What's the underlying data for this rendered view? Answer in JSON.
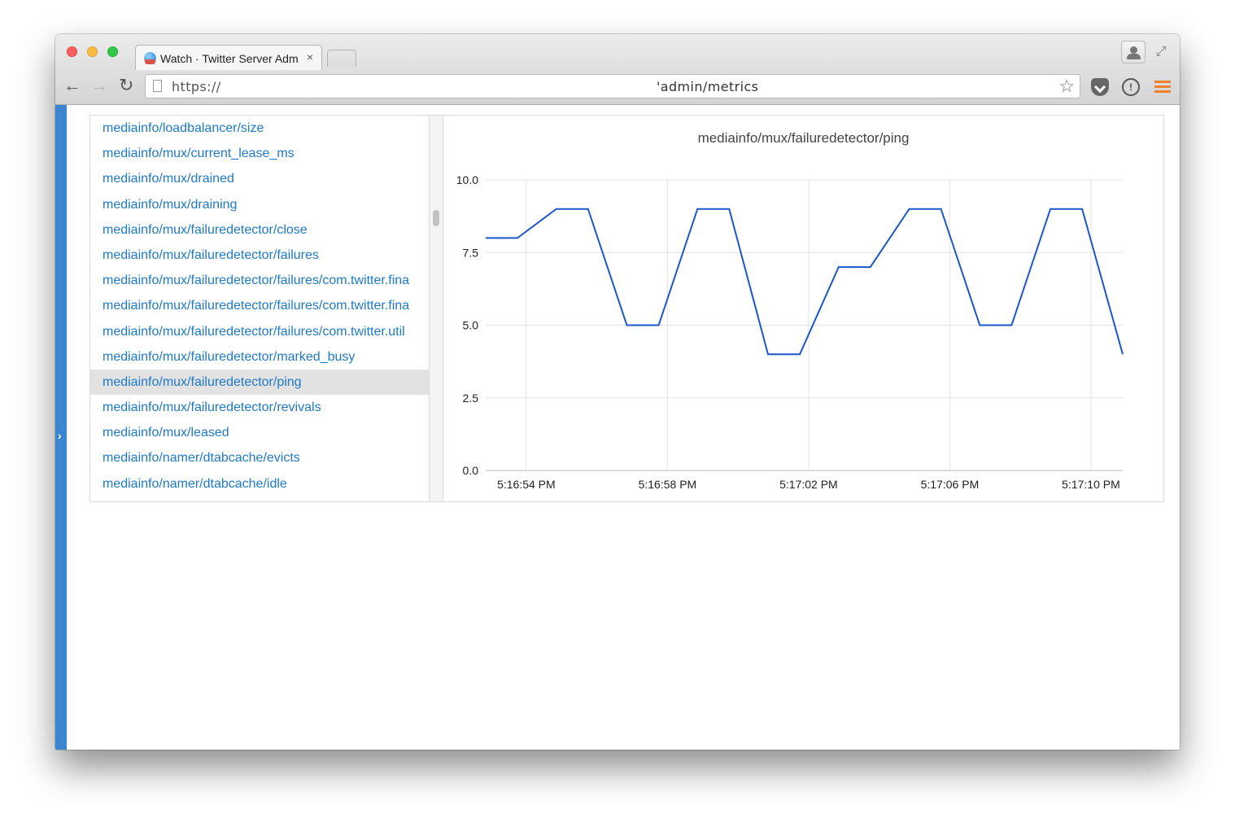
{
  "browser": {
    "tab_title": "Watch · Twitter Server Adm",
    "tab_close": "×",
    "url_scheme": "https://",
    "url_path": "'admin/metrics"
  },
  "metrics": {
    "items": [
      "mediainfo/loadbalancer/size",
      "mediainfo/mux/current_lease_ms",
      "mediainfo/mux/drained",
      "mediainfo/mux/draining",
      "mediainfo/mux/failuredetector/close",
      "mediainfo/mux/failuredetector/failures",
      "mediainfo/mux/failuredetector/failures/com.twitter.fina",
      "mediainfo/mux/failuredetector/failures/com.twitter.fina",
      "mediainfo/mux/failuredetector/failures/com.twitter.util",
      "mediainfo/mux/failuredetector/marked_busy",
      "mediainfo/mux/failuredetector/ping",
      "mediainfo/mux/failuredetector/revivals",
      "mediainfo/mux/leased",
      "mediainfo/namer/dtabcache/evicts",
      "mediainfo/namer/dtabcache/idle"
    ],
    "selected_index": 10
  },
  "chart_data": {
    "type": "line",
    "title": "mediainfo/mux/failuredetector/ping",
    "xlabel": "",
    "ylabel": "",
    "ylim": [
      0,
      10
    ],
    "yticks": [
      "0.0",
      "2.5",
      "5.0",
      "7.5",
      "10.0"
    ],
    "xticks": [
      "5:16:54 PM",
      "5:16:58 PM",
      "5:17:02 PM",
      "5:17:06 PM",
      "5:17:10 PM"
    ],
    "xlim_seconds": [
      -1.15,
      16.9
    ],
    "grid": true,
    "color": "#1a56cc",
    "series": [
      {
        "x": [
          -1.15,
          -0.25,
          0.85,
          1.75,
          2.85,
          3.75,
          4.85,
          5.75,
          6.85,
          7.75,
          8.85,
          9.75,
          10.85,
          11.75,
          12.85,
          13.75,
          14.85,
          15.75,
          16.9
        ],
        "y": [
          8,
          8,
          9,
          9,
          5,
          5,
          9,
          9,
          4,
          4,
          7,
          7,
          9,
          9,
          5,
          5,
          9,
          9,
          4
        ]
      }
    ]
  }
}
